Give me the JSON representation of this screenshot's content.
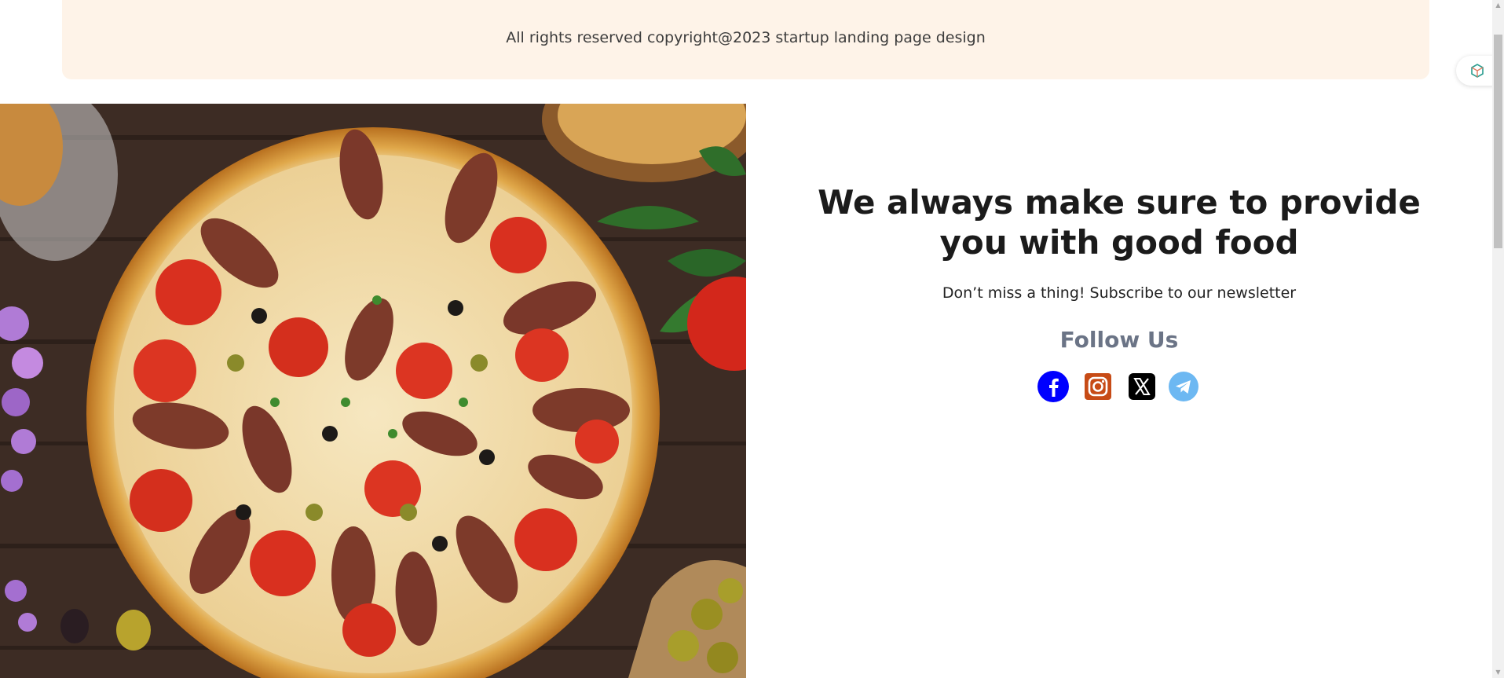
{
  "footer": {
    "copyright": "All rights reserved copyright@2023 startup landing page design"
  },
  "newsletter": {
    "headline": "We always make sure to provide you with good food",
    "subline": "Don’t miss a thing! Subscribe to our newsletter",
    "follow_title": "Follow Us"
  },
  "social": [
    {
      "name": "facebook-icon",
      "color": "#0000ff"
    },
    {
      "name": "instagram-icon",
      "color": "#c74b16"
    },
    {
      "name": "x-icon",
      "color": "#000000"
    },
    {
      "name": "telegram-icon",
      "color": "#6db8f2"
    }
  ],
  "colors": {
    "footer_bg": "#fef3e8",
    "follow_title": "#6b7486"
  }
}
